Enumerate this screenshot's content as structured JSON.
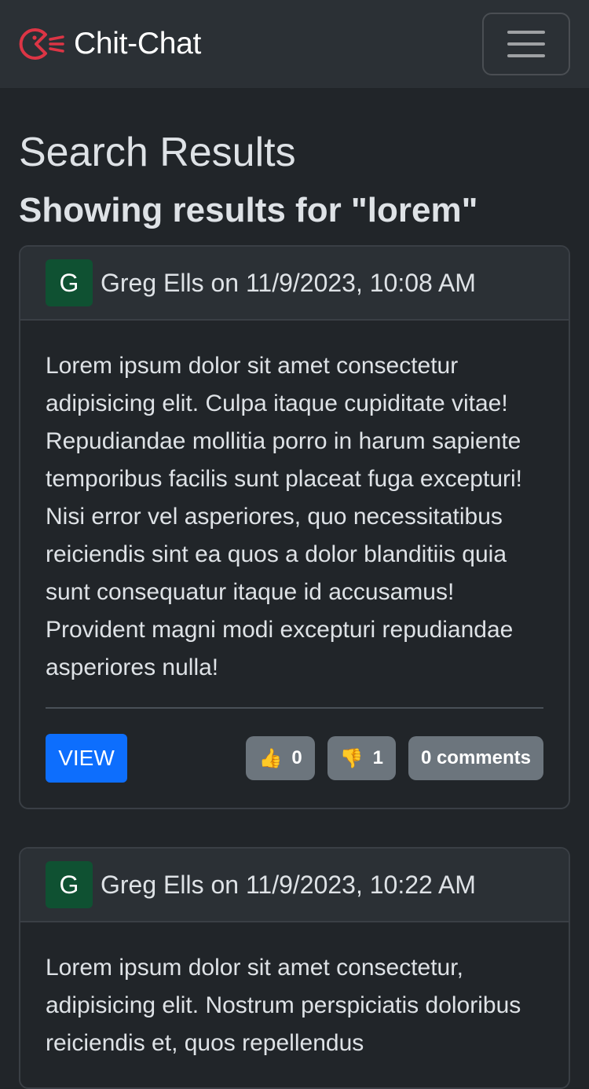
{
  "nav": {
    "brand": "Chit-Chat",
    "brand_color": "#dc3545"
  },
  "page": {
    "title": "Search Results",
    "subtitle": "Showing results for \"lorem\""
  },
  "posts": [
    {
      "avatar": "G",
      "meta": "Greg Ells on 11/9/2023, 10:08 AM",
      "body": "Lorem ipsum dolor sit amet consectetur adipisicing elit. Culpa itaque cupiditate vitae! Repudiandae mollitia porro in harum sapiente temporibus facilis sunt placeat fuga excepturi! Nisi error vel asperiores, quo necessitatibus reiciendis sint ea quos a dolor blanditiis quia sunt consequatur itaque id accusamus! Provident magni modi excepturi repudiandae asperiores nulla!",
      "view_label": "VIEW",
      "likes": "0",
      "dislikes": "1",
      "comments": "0 comments"
    },
    {
      "avatar": "G",
      "meta": "Greg Ells on 11/9/2023, 10:22 AM",
      "body": "Lorem ipsum dolor sit amet consectetur, adipisicing elit. Nostrum perspiciatis doloribus reiciendis et, quos repellendus"
    }
  ],
  "icons": {
    "like": "thumbs-up-icon",
    "dislike": "thumbs-down-icon",
    "menu": "hamburger-menu-icon",
    "logo": "chit-chat-logo-icon"
  }
}
